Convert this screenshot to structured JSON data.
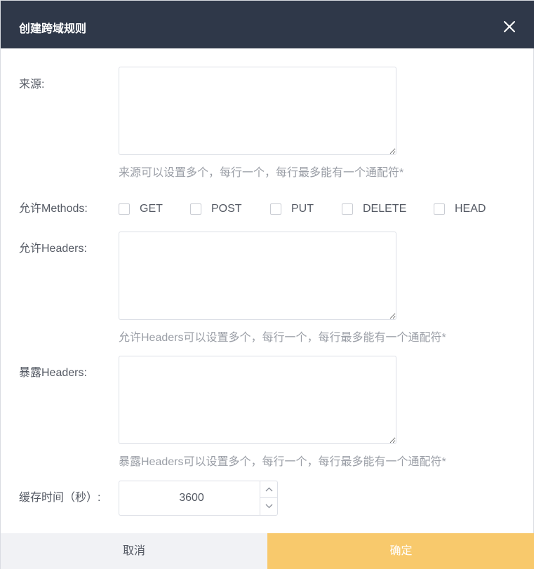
{
  "dialog": {
    "title": "创建跨域规则"
  },
  "form": {
    "origin": {
      "label": "来源:",
      "value": "",
      "hint": "来源可以设置多个，每行一个，每行最多能有一个通配符*"
    },
    "methods": {
      "label": "允许Methods:",
      "options": [
        {
          "label": "GET",
          "checked": false
        },
        {
          "label": "POST",
          "checked": false
        },
        {
          "label": "PUT",
          "checked": false
        },
        {
          "label": "DELETE",
          "checked": false
        },
        {
          "label": "HEAD",
          "checked": false
        }
      ]
    },
    "allow_headers": {
      "label": "允许Headers:",
      "value": "",
      "hint": "允许Headers可以设置多个，每行一个，每行最多能有一个通配符*"
    },
    "expose_headers": {
      "label": "暴露Headers:",
      "value": "",
      "hint": "暴露Headers可以设置多个，每行一个，每行最多能有一个通配符*"
    },
    "cache_time": {
      "label": "缓存时间（秒）:",
      "value": "3600"
    }
  },
  "footer": {
    "cancel_label": "取消",
    "ok_label": "确定"
  },
  "colors": {
    "header_bg": "#2f3849",
    "primary": "#f8c96c",
    "cancel_bg": "#f1f2f5"
  },
  "icons": {
    "close": "close-icon",
    "stepper_up": "chevron-up-icon",
    "stepper_down": "chevron-down-icon"
  }
}
